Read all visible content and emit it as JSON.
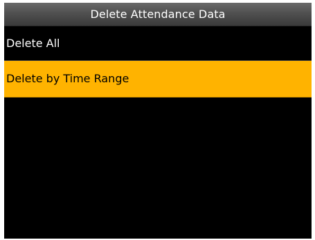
{
  "screen": {
    "title": "Delete Attendance Data",
    "selected_color": "#ffb300",
    "background_color": "#000000",
    "items": [
      {
        "label": "Delete All",
        "selected": false
      },
      {
        "label": "Delete by Time Range",
        "selected": true
      }
    ]
  }
}
